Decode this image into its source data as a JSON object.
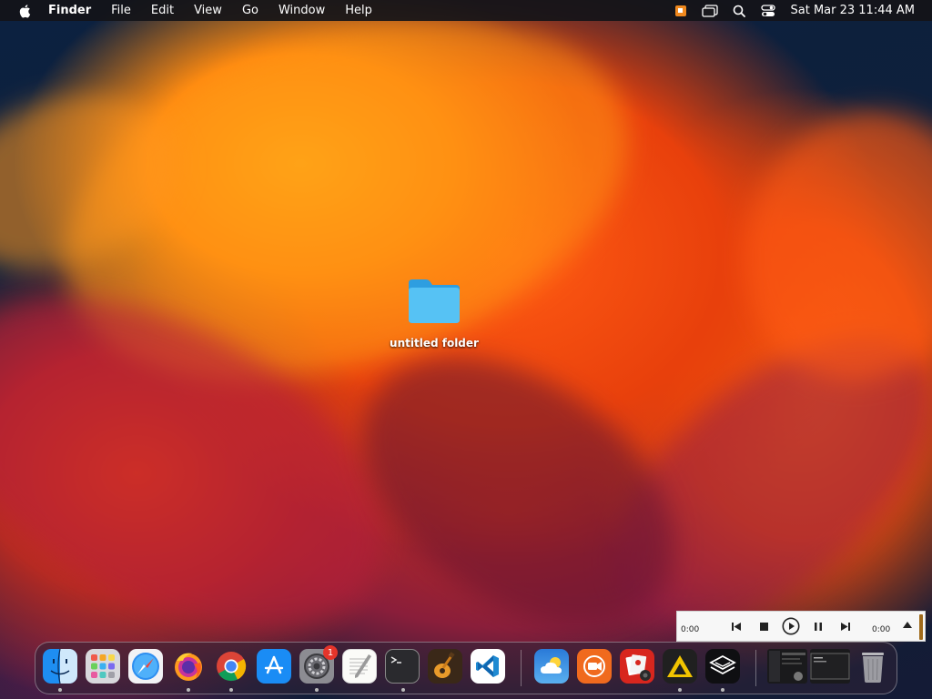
{
  "menubar": {
    "apple_icon": "apple-logo-icon",
    "app_name": "Finder",
    "items": [
      "File",
      "Edit",
      "View",
      "Go",
      "Window",
      "Help"
    ],
    "status_icons": [
      "media-player-icon",
      "window-switcher-icon",
      "spotlight-search-icon",
      "control-center-icon"
    ],
    "clock": "Sat Mar 23  11:44 AM"
  },
  "desktop": {
    "folder_label": "untitled folder",
    "folder_color": "#4cb8f0"
  },
  "player": {
    "elapsed": "0:00",
    "remaining": "0:00"
  },
  "dock": {
    "apps": [
      {
        "name": "Finder",
        "icon": "finder-icon",
        "running": true
      },
      {
        "name": "Launchpad",
        "icon": "launchpad-icon",
        "running": false
      },
      {
        "name": "Safari",
        "icon": "safari-icon",
        "running": false
      },
      {
        "name": "Firefox",
        "icon": "firefox-icon",
        "running": true
      },
      {
        "name": "Chrome",
        "icon": "chrome-icon",
        "running": true
      },
      {
        "name": "App Store",
        "icon": "app-store-icon",
        "running": false
      },
      {
        "name": "System Settings",
        "icon": "system-settings-icon",
        "running": true,
        "badge": "1"
      },
      {
        "name": "TextEdit",
        "icon": "textedit-icon",
        "running": false
      },
      {
        "name": "Terminal",
        "icon": "terminal-icon",
        "running": true
      },
      {
        "name": "GarageBand",
        "icon": "garageband-icon",
        "running": false
      },
      {
        "name": "VS Code",
        "icon": "vscode-icon",
        "running": false
      },
      {
        "name": "Weather",
        "icon": "weather-icon",
        "running": false
      },
      {
        "name": "Screen Recorder",
        "icon": "screen-recorder-icon",
        "running": false
      },
      {
        "name": "Photo Booth",
        "icon": "photo-booth-icon",
        "running": false
      },
      {
        "name": "Triangle App",
        "icon": "triangle-app-icon",
        "running": true
      },
      {
        "name": "Layers App",
        "icon": "layers-app-icon",
        "running": true
      },
      {
        "name": "Minimized Window 1",
        "icon": "minimized-window-icon",
        "running": false
      },
      {
        "name": "Minimized Window 2",
        "icon": "minimized-terminal-window-icon",
        "running": false
      },
      {
        "name": "Trash",
        "icon": "trash-icon",
        "running": false
      }
    ]
  }
}
